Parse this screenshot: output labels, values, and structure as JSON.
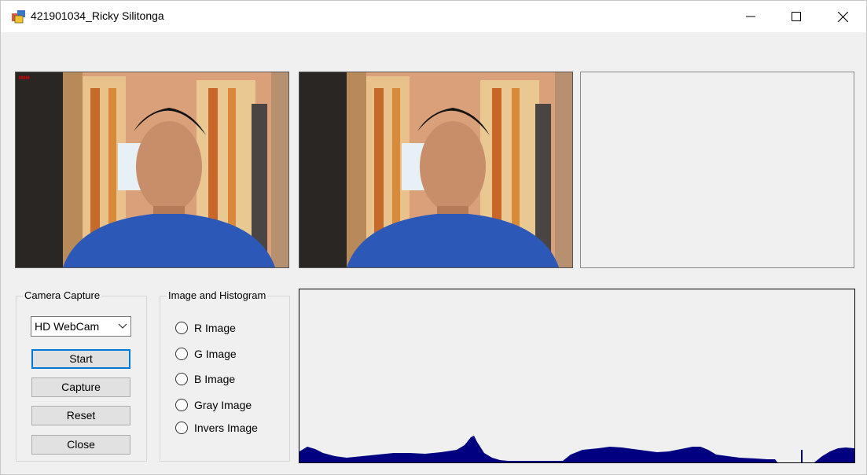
{
  "window": {
    "title": "421901034_Ricky Silitonga"
  },
  "camera_group": {
    "label": "Camera Capture",
    "device_select": "HD WebCam",
    "buttons": {
      "start": "Start",
      "capture": "Capture",
      "reset": "Reset",
      "close": "Close"
    }
  },
  "histogram_group": {
    "label": "Image and Histogram",
    "options": [
      "R Image",
      "G Image",
      "B Image",
      "Gray Image",
      "Invers Image"
    ]
  },
  "colors": {
    "histogram_fill": "#000080",
    "focus_border": "#0078d7"
  },
  "icons": {
    "app": "app-icon",
    "minimize": "minimize-icon",
    "maximize": "maximize-icon",
    "close": "close-icon",
    "dropdown": "chevron-down-icon"
  }
}
